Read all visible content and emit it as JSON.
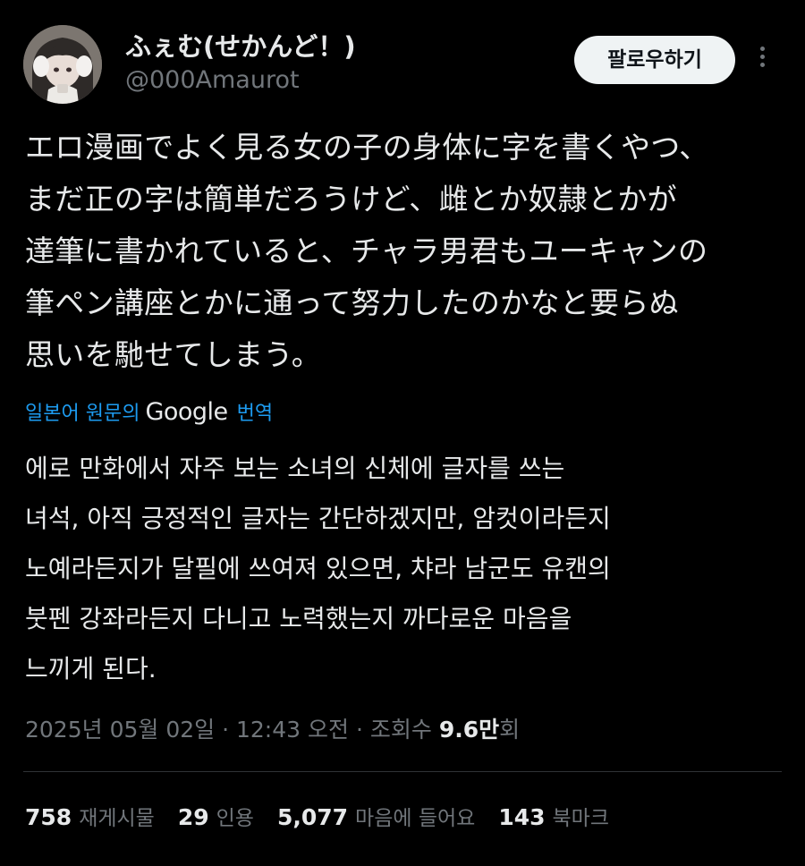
{
  "author": {
    "display_name": "ふぇむ(せかんど！)",
    "handle": "@000Amaurot",
    "avatar": "avatar-illustration"
  },
  "follow_button_label": "팔로우하기",
  "more_icon": "more-vertical-icon",
  "tweet": {
    "lines": [
      "エロ漫画でよく見る女の子の身体に字を書くやつ、",
      "まだ正の字は簡単だろうけど、雌とか奴隷とかが",
      "達筆に書かれていると、チャラ男君もユーキャンの",
      "筆ペン講座とかに通って努力したのかなと要らぬ",
      "思いを馳せてしまう。"
    ]
  },
  "translation": {
    "prefix": "일본어 원문의",
    "provider": "Google",
    "suffix": "번역",
    "lines": [
      "에로 만화에서 자주 보는 소녀의 신체에 글자를 쓰는",
      "녀석, 아직 긍정적인 글자는 간단하겠지만, 암컷이라든지",
      "노예라든지가 달필에 쓰여져 있으면, 챠라 남군도 유캔의",
      "붓펜 강좌라든지 다니고 노력했는지 까다로운 마음을",
      "느끼게 된다."
    ]
  },
  "meta": {
    "date": "2025년 05월 02일",
    "separator": "·",
    "time": "12:43 오전",
    "views_label": "조회수",
    "views_count": "9.6만",
    "views_unit": "회"
  },
  "stats": [
    {
      "count": "758",
      "label": "재게시물"
    },
    {
      "count": "29",
      "label": "인용"
    },
    {
      "count": "5,077",
      "label": "마음에 들어요"
    },
    {
      "count": "143",
      "label": "북마크"
    }
  ],
  "colors": {
    "background": "#000000",
    "text": "#e7e9ea",
    "secondary": "#71767b",
    "link": "#1d9bf0",
    "button_bg": "#eff3f4",
    "divider": "#2f3336"
  }
}
